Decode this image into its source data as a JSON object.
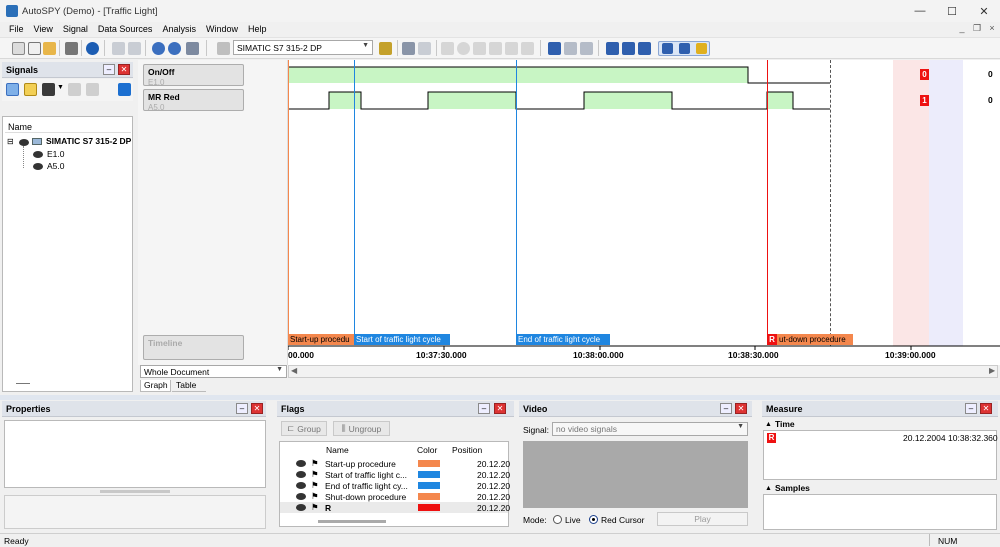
{
  "window": {
    "title": "AutoSPY (Demo) - [Traffic Light]",
    "min": "—",
    "max": "☐",
    "close": "✕"
  },
  "menu": [
    "File",
    "View",
    "Signal",
    "Data Sources",
    "Analysis",
    "Window",
    "Help"
  ],
  "toolbar": {
    "device_combo": "SIMATIC S7 315-2 DP"
  },
  "signals_panel": {
    "title": "Signals",
    "name_header": "Name",
    "tree": [
      {
        "label": "SIMATIC S7 315-2 DP",
        "level": 0
      },
      {
        "label": "E1.0",
        "level": 1
      },
      {
        "label": "A5.0",
        "level": 1
      }
    ]
  },
  "graph": {
    "signals": [
      {
        "name": "On/Off",
        "address": "E1.0",
        "cursor_value": "0",
        "marker": "0"
      },
      {
        "name": "MR Red",
        "address": "A5.0",
        "cursor_value": "0",
        "marker": "1"
      }
    ],
    "timeline_label": "Timeline",
    "flags": [
      {
        "label": "Start-up procedu",
        "color": "#f4874d"
      },
      {
        "label": "Start of traffic light cycle",
        "color": "#1f86e0"
      },
      {
        "label": "End of traffic light cycle",
        "color": "#1f86e0"
      },
      {
        "label": "ut-down procedure",
        "color": "#f4874d",
        "marker": "R"
      }
    ],
    "ticks": [
      "00.000",
      "10:37:30.000",
      "10:38:00.000",
      "10:38:30.000",
      "10:39:00.000"
    ],
    "scope_select": "Whole Document",
    "tabs": [
      "Graph",
      "Table"
    ]
  },
  "properties_panel": {
    "title": "Properties"
  },
  "flags_panel": {
    "title": "Flags",
    "group_btn": "Group",
    "ungroup_btn": "Ungroup",
    "columns": [
      "Name",
      "Color",
      "Position"
    ],
    "rows": [
      {
        "name": "Start-up procedure",
        "color": "#f4874d",
        "position": "20.12.20"
      },
      {
        "name": "Start of traffic light c...",
        "color": "#1f86e0",
        "position": "20.12.20"
      },
      {
        "name": "End of traffic light cy...",
        "color": "#1f86e0",
        "position": "20.12.20"
      },
      {
        "name": "Shut-down procedure",
        "color": "#f4874d",
        "position": "20.12.20"
      },
      {
        "name": "R",
        "color": "#ee1111",
        "position": "20.12.20"
      }
    ]
  },
  "video_panel": {
    "title": "Video",
    "signal_label": "Signal:",
    "signal_value": "no video signals",
    "mode_label": "Mode:",
    "mode_live": "Live",
    "mode_red": "Red Cursor",
    "play": "Play"
  },
  "measure_panel": {
    "title": "Measure",
    "time_section": "Time",
    "marker": "R",
    "date": "20.12.2004",
    "time": "10:38:32.360",
    "samples_section": "Samples"
  },
  "status": {
    "left": "Ready",
    "num": "NUM"
  }
}
